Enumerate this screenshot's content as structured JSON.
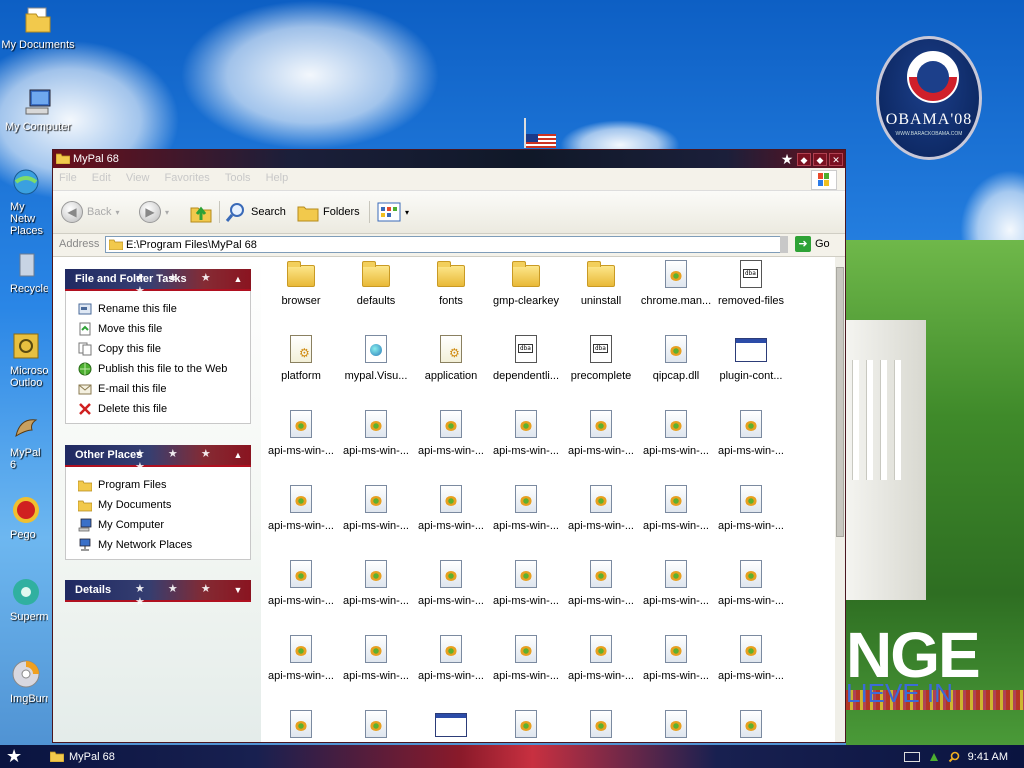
{
  "desktop": {
    "icons": [
      {
        "label": "My Documents",
        "icon": "folder-icon"
      },
      {
        "label": "My Computer",
        "icon": "computer-icon"
      },
      {
        "label": "My Network Places",
        "icon": "network-icon",
        "visible_label": "My Netw\nPlaces"
      },
      {
        "label": "Recycle",
        "icon": "recycle-bin-icon"
      },
      {
        "label": "Microso Outloo",
        "icon": "outlook-icon"
      },
      {
        "label": "MyPal 6",
        "icon": "mypal-icon"
      },
      {
        "label": "Pego",
        "icon": "pego-icon"
      },
      {
        "label": "Supermi",
        "icon": "supermium-icon"
      },
      {
        "label": "ImgBurn",
        "icon": "imgburn-icon"
      }
    ],
    "wallpaper": {
      "badge_text": "OBAMA'08",
      "badge_small": "WWW.BARACKOBAMA.COM",
      "change_text": "NGE",
      "believe_text": "LIEVE IN"
    }
  },
  "window": {
    "title": "MyPal 68",
    "menu": [
      "File",
      "Edit",
      "View",
      "Favorites",
      "Tools",
      "Help"
    ],
    "toolbar": {
      "back_label": "Back",
      "search_label": "Search",
      "folders_label": "Folders"
    },
    "address": {
      "label": "Address",
      "value": "E:\\Program Files\\MyPal 68",
      "go_label": "Go"
    },
    "tasks_panel": {
      "title": "File and Folder Tasks",
      "items": [
        {
          "label": "Rename this file",
          "icon": "rename-icon"
        },
        {
          "label": "Move this file",
          "icon": "move-icon"
        },
        {
          "label": "Copy this file",
          "icon": "copy-icon"
        },
        {
          "label": "Publish this file to the Web",
          "icon": "publish-web-icon"
        },
        {
          "label": "E-mail this file",
          "icon": "email-icon"
        },
        {
          "label": "Delete this file",
          "icon": "delete-icon"
        }
      ]
    },
    "places_panel": {
      "title": "Other Places",
      "items": [
        {
          "label": "Program Files",
          "icon": "folder-icon"
        },
        {
          "label": "My Documents",
          "icon": "folder-icon"
        },
        {
          "label": "My Computer",
          "icon": "computer-icon"
        },
        {
          "label": "My Network Places",
          "icon": "network-icon"
        }
      ]
    },
    "details_panel": {
      "title": "Details"
    },
    "files": [
      [
        {
          "name": "browser",
          "type": "folder"
        },
        {
          "name": "defaults",
          "type": "folder"
        },
        {
          "name": "fonts",
          "type": "folder"
        },
        {
          "name": "gmp-clearkey",
          "type": "folder"
        },
        {
          "name": "uninstall",
          "type": "folder"
        },
        {
          "name": "chrome.man...",
          "type": "dll"
        },
        {
          "name": "removed-files",
          "type": "sfile"
        }
      ],
      [
        {
          "name": "platform",
          "type": "cfg"
        },
        {
          "name": "mypal.Visu...",
          "type": "web"
        },
        {
          "name": "application",
          "type": "cfg"
        },
        {
          "name": "dependentli...",
          "type": "sfile"
        },
        {
          "name": "precomplete",
          "type": "sfile"
        },
        {
          "name": "qipcap.dll",
          "type": "dll"
        },
        {
          "name": "plugin-cont...",
          "type": "exe"
        }
      ],
      [
        {
          "name": "api-ms-win-...",
          "type": "dll"
        },
        {
          "name": "api-ms-win-...",
          "type": "dll"
        },
        {
          "name": "api-ms-win-...",
          "type": "dll"
        },
        {
          "name": "api-ms-win-...",
          "type": "dll"
        },
        {
          "name": "api-ms-win-...",
          "type": "dll"
        },
        {
          "name": "api-ms-win-...",
          "type": "dll"
        },
        {
          "name": "api-ms-win-...",
          "type": "dll"
        }
      ],
      [
        {
          "name": "api-ms-win-...",
          "type": "dll"
        },
        {
          "name": "api-ms-win-...",
          "type": "dll"
        },
        {
          "name": "api-ms-win-...",
          "type": "dll"
        },
        {
          "name": "api-ms-win-...",
          "type": "dll"
        },
        {
          "name": "api-ms-win-...",
          "type": "dll"
        },
        {
          "name": "api-ms-win-...",
          "type": "dll"
        },
        {
          "name": "api-ms-win-...",
          "type": "dll"
        }
      ],
      [
        {
          "name": "api-ms-win-...",
          "type": "dll"
        },
        {
          "name": "api-ms-win-...",
          "type": "dll"
        },
        {
          "name": "api-ms-win-...",
          "type": "dll"
        },
        {
          "name": "api-ms-win-...",
          "type": "dll"
        },
        {
          "name": "api-ms-win-...",
          "type": "dll"
        },
        {
          "name": "api-ms-win-...",
          "type": "dll"
        },
        {
          "name": "api-ms-win-...",
          "type": "dll"
        }
      ],
      [
        {
          "name": "api-ms-win-...",
          "type": "dll"
        },
        {
          "name": "api-ms-win-...",
          "type": "dll"
        },
        {
          "name": "api-ms-win-...",
          "type": "dll"
        },
        {
          "name": "api-ms-win-...",
          "type": "dll"
        },
        {
          "name": "api-ms-win-...",
          "type": "dll"
        },
        {
          "name": "api-ms-win-...",
          "type": "dll"
        },
        {
          "name": "api-ms-win-...",
          "type": "dll"
        }
      ],
      [
        {
          "name": "",
          "type": "dll"
        },
        {
          "name": "",
          "type": "dll"
        },
        {
          "name": "",
          "type": "exe"
        },
        {
          "name": "",
          "type": "dll"
        },
        {
          "name": "",
          "type": "dll"
        },
        {
          "name": "",
          "type": "dll"
        },
        {
          "name": "",
          "type": "dll"
        }
      ]
    ]
  },
  "taskbar": {
    "task_label": "MyPal 68",
    "clock": "9:41 AM"
  },
  "colors": {
    "titlebar_accent": "#6b0f1a",
    "panel_blue": "#141e5a",
    "panel_red": "#8a1420",
    "go_green": "#2ea236"
  }
}
